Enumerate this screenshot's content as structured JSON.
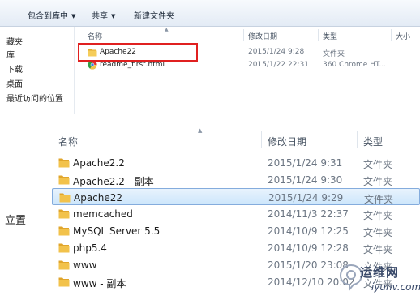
{
  "toolbar": {
    "include_in_library": "包含到库中",
    "share": "共享",
    "new_folder": "新建文件夹"
  },
  "top_nav": [
    {
      "label": "藏夹"
    },
    {
      "label": "库"
    },
    {
      "label": "下载"
    },
    {
      "label": "桌面"
    },
    {
      "label": "最近访问的位置"
    }
  ],
  "top_columns": {
    "name": "名称",
    "date": "修改日期",
    "type": "类型",
    "size": "大小"
  },
  "top_files": [
    {
      "name": "Apache22",
      "date": "2015/1/24 9:28",
      "type": "文件夹",
      "icon": "folder-icon",
      "highlighted": true
    },
    {
      "name": "readme_first.html",
      "date": "2015/1/22 22:31",
      "type": "360 Chrome HT...",
      "icon": "browser-icon",
      "highlighted": false
    }
  ],
  "bottom_columns": {
    "name": "名称",
    "date": "修改日期",
    "type": "类型"
  },
  "bottom_side_label": "立置",
  "bottom_files": [
    {
      "name": "Apache2.2",
      "date": "2015/1/24 9:31",
      "type": "文件夹",
      "icon": "folder-icon",
      "selected": false
    },
    {
      "name": "Apache2.2 - 副本",
      "date": "2015/1/24 9:30",
      "type": "文件夹",
      "icon": "folder-icon",
      "selected": false
    },
    {
      "name": "Apache22",
      "date": "2015/1/24 9:29",
      "type": "文件夹",
      "icon": "folder-icon",
      "selected": true
    },
    {
      "name": "memcached",
      "date": "2014/11/3 22:37",
      "type": "文件夹",
      "icon": "folder-icon",
      "selected": false
    },
    {
      "name": "MySQL Server 5.5",
      "date": "2014/10/9 12:25",
      "type": "文件夹",
      "icon": "folder-icon",
      "selected": false
    },
    {
      "name": "php5.4",
      "date": "2014/10/9 12:28",
      "type": "文件夹",
      "icon": "folder-icon",
      "selected": false
    },
    {
      "name": "www",
      "date": "2015/1/20 23:08",
      "type": "文件夹",
      "icon": "folder-icon",
      "selected": false
    },
    {
      "name": "www - 副本",
      "date": "2014/12/10 20:02",
      "type": "文件夹",
      "icon": "folder-icon",
      "selected": false
    }
  ],
  "watermark": {
    "text_cn": "运维网",
    "text_en": "iyunv.com"
  },
  "colors": {
    "highlight_border": "#e02020",
    "selection_fill": "#cde6fb",
    "selection_border": "#84acdd",
    "folder_yellow": "#f2c24b"
  }
}
